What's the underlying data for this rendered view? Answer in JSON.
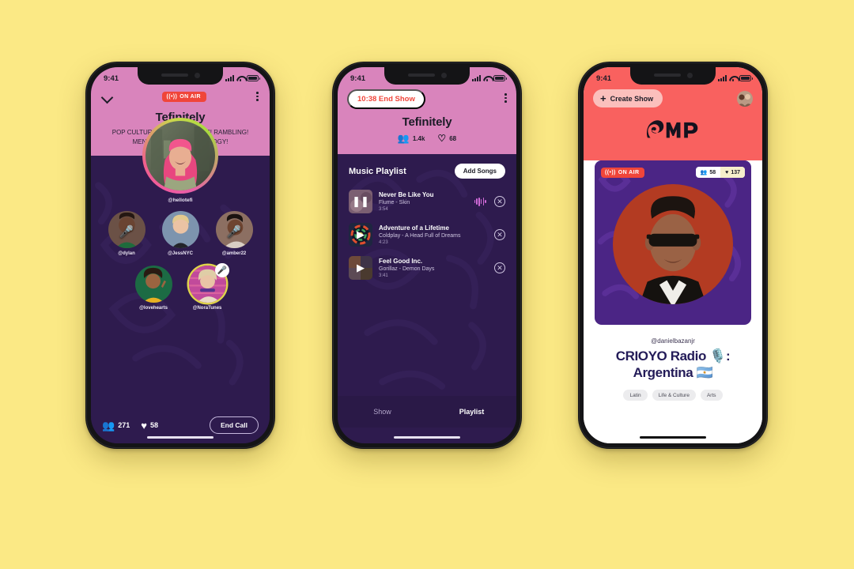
{
  "meta": {
    "background_color": "#FBE985",
    "brand": "AMP"
  },
  "status_bar": {
    "time": "9:41",
    "signal_icon": "cellular-bars-icon",
    "wifi_icon": "wifi-icon",
    "battery_icon": "battery-icon"
  },
  "phone1": {
    "collapse_icon": "chevron-down-icon",
    "on_air_label": "ON AIR",
    "on_air_icon": "broadcast-icon",
    "menu_icon": "kebab-menu-icon",
    "title": "Tefinitely",
    "description": "POP CULTURE! RELATIONSHIPS! RAMBLING! MENTAL HEALTH! ASTROLOGY!",
    "host": {
      "handle": "@hellotefi"
    },
    "guests": [
      {
        "handle": "@dylan",
        "muted": true
      },
      {
        "handle": "@JessNYC",
        "muted": false
      },
      {
        "handle": "@amber22",
        "muted": true
      },
      {
        "handle": "@lovehearts",
        "muted": false
      },
      {
        "handle": "@NoraTunes",
        "muted": false,
        "speaking": true
      }
    ],
    "footer": {
      "listeners_icon": "people-icon",
      "listeners": "271",
      "likes_icon": "heart-icon",
      "likes": "58",
      "end_call_label": "End Call"
    }
  },
  "phone2": {
    "end_show_label": "10:38 End Show",
    "menu_icon": "kebab-menu-icon",
    "title": "Tefinitely",
    "listeners_icon": "people-icon",
    "listeners": "1.4k",
    "likes_icon": "heart-icon",
    "likes": "68",
    "playlist_title": "Music Playlist",
    "add_songs_label": "Add Songs",
    "songs": [
      {
        "title": "Never Be Like You",
        "subtitle": "Flume - Skin",
        "duration": "3:54",
        "state": "playing",
        "state_icon": "pause-icon",
        "remove_icon": "close-circle-icon",
        "waveform_icon": "waveform-icon"
      },
      {
        "title": "Adventure of a Lifetime",
        "subtitle": "Coldplay - A Head Full of Dreams",
        "duration": "4:23",
        "state": "queued",
        "state_icon": "play-icon",
        "remove_icon": "close-circle-icon"
      },
      {
        "title": "Feel Good Inc.",
        "subtitle": "Gorillaz - Demon Days",
        "duration": "3:41",
        "state": "queued",
        "state_icon": "play-icon",
        "remove_icon": "close-circle-icon"
      }
    ],
    "tabs": [
      {
        "label": "Show",
        "active": false
      },
      {
        "label": "Playlist",
        "active": true
      }
    ]
  },
  "phone3": {
    "create_show_label": "Create Show",
    "create_show_icon": "plus-icon",
    "profile_icon": "avatar",
    "logo_text": "AMP",
    "card": {
      "on_air_label": "ON AIR",
      "on_air_icon": "broadcast-icon",
      "listeners_icon": "people-icon",
      "listeners": "58",
      "likes_icon": "heart-icon",
      "likes": "137"
    },
    "handle": "@danielbazanjr",
    "title_line1": "CRIOYO Radio 🎙️:",
    "title_line2": "Argentina 🇦🇷",
    "tags": [
      "Latin",
      "Life & Culture",
      "Arts"
    ]
  }
}
